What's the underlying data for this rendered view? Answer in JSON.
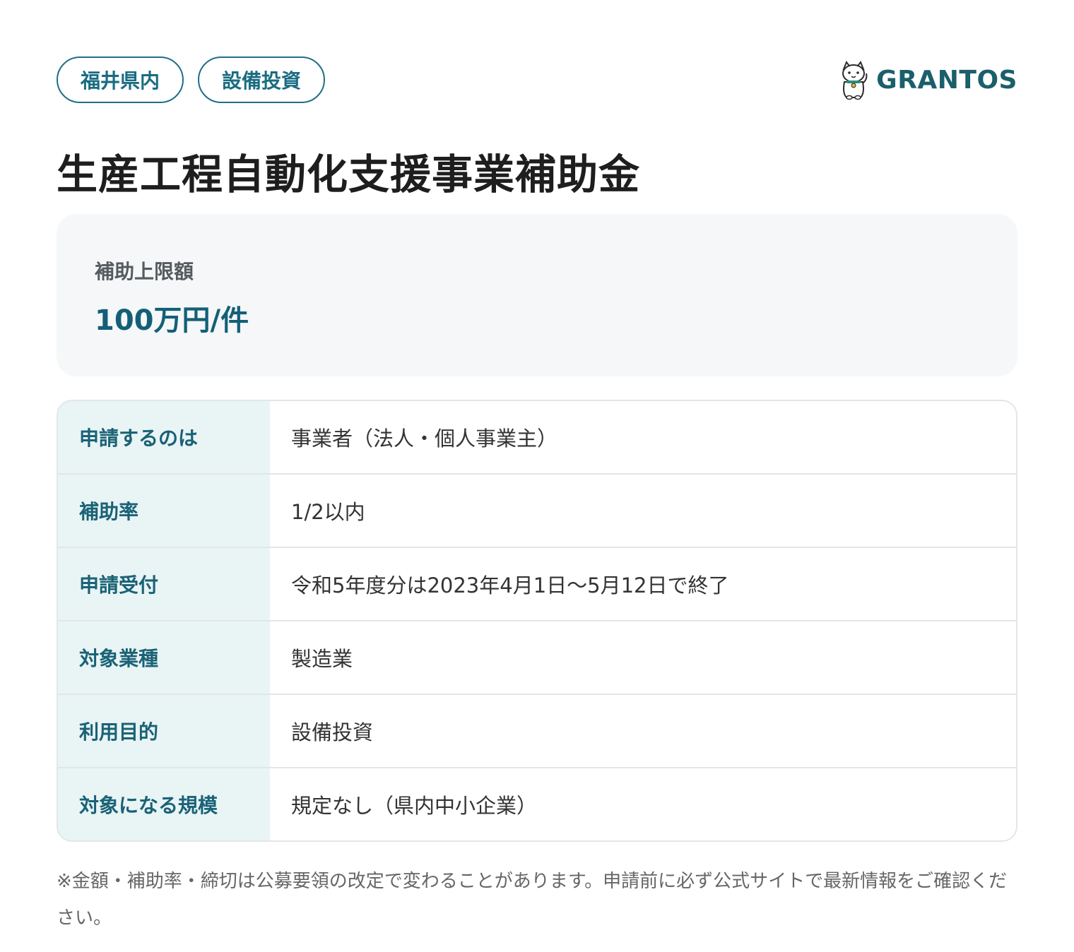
{
  "tags": [
    "福井県内",
    "設備投資"
  ],
  "brand": {
    "name": "GRANTOS",
    "icon": "maneki-neko-icon"
  },
  "title": "生産工程自動化支援事業補助金",
  "summary": {
    "label": "補助上限額",
    "value": "100万円/件"
  },
  "table": [
    {
      "key": "申請するのは",
      "value": "事業者（法人・個人事業主）"
    },
    {
      "key": "補助率",
      "value": "1/2以内"
    },
    {
      "key": "申請受付",
      "value": "令和5年度分は2023年4月1日〜5月12日で終了"
    },
    {
      "key": "対象業種",
      "value": "製造業"
    },
    {
      "key": "利用目的",
      "value": "設備投資"
    },
    {
      "key": "対象になる規模",
      "value": "規定なし（県内中小企業）"
    }
  ],
  "note": "※金額・補助率・締切は公募要領の改定で変わることがあります。申請前に必ず公式サイトで最新情報をご確認ください。",
  "colors": {
    "accent": "#1a6c82",
    "brand": "#1a5f6b",
    "key_bg": "#e9f4f5",
    "panel_bg": "#f5f7f8"
  }
}
